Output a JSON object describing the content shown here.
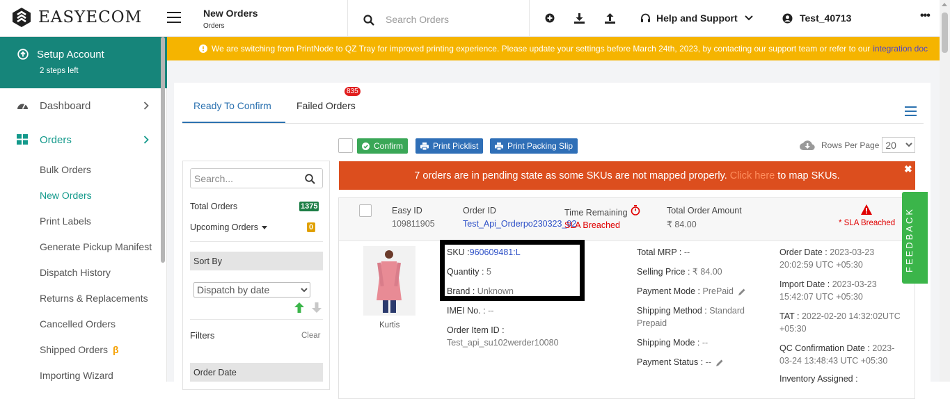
{
  "app": {
    "brand": "EASYECOM"
  },
  "header": {
    "page_title": "New Orders",
    "breadcrumb": "Orders",
    "search_placeholder": "Search Orders",
    "help_label": "Help and Support",
    "user_label": "Test_40713",
    "more_label": "•••"
  },
  "sidebar": {
    "setup": {
      "title": "Setup Account",
      "subtitle": "2 steps left"
    },
    "main_items": [
      {
        "label": "Dashboard",
        "icon": "dashboard-gauge-icon",
        "active": false
      },
      {
        "label": "Orders",
        "icon": "grid-icon",
        "active": true
      }
    ],
    "sub_items": [
      {
        "label": "Bulk Orders",
        "active": false
      },
      {
        "label": "New Orders",
        "active": true
      },
      {
        "label": "Print Labels",
        "active": false
      },
      {
        "label": "Generate Pickup Manifest",
        "active": false
      },
      {
        "label": "Dispatch History",
        "active": false
      },
      {
        "label": "Returns & Replacements",
        "active": false
      },
      {
        "label": "Cancelled Orders",
        "active": false
      },
      {
        "label": "Shipped Orders",
        "active": false,
        "beta": "β"
      },
      {
        "label": "Importing Wizard",
        "active": false
      }
    ]
  },
  "notice": {
    "message": "We are switching from PrintNode to QZ Tray for improved printing experience. Please update your settings before March 24th, 2023, by contacting our support team or refer to our",
    "link": "integration doc"
  },
  "tabs": [
    {
      "label": "Ready To Confirm",
      "active": true
    },
    {
      "label": "Failed Orders",
      "active": false,
      "badge": "835"
    }
  ],
  "toolbar": {
    "confirm": "Confirm",
    "print_picklist": "Print Picklist",
    "print_packing_slip": "Print Packing Slip",
    "rows_per_page_label": "Rows Per Page",
    "rows_per_page_value": "20"
  },
  "filters": {
    "search_placeholder": "Search...",
    "total_orders_label": "Total Orders",
    "total_orders_count": "1375",
    "upcoming_orders_label": "Upcoming Orders",
    "upcoming_orders_count": "0",
    "sort_by_label": "Sort By",
    "sort_value": "Dispatch by date",
    "filters_label": "Filters",
    "clear_label": "Clear",
    "order_date_label": "Order Date"
  },
  "alert": {
    "message": "7 orders are in pending state as some SKUs are not mapped properly.",
    "link": "Click here",
    "suffix": "to map SKUs.",
    "close": "✖"
  },
  "order": {
    "easy_id_label": "Easy ID",
    "easy_id": "109811905",
    "order_id_label": "Order ID",
    "order_id": "Test_Api_Orderpo230323_92",
    "time_remaining_label": "Time Remaining",
    "time_remaining_value": "SLA Breached",
    "total_amount_label": "Total Order Amount",
    "total_amount": "₹ 84.00",
    "sla_status": "* SLA Breached",
    "product_caption": "Kurtis",
    "sku_label": "SKU :",
    "sku": "960609481:L",
    "quantity_label": "Quantity :",
    "quantity": "5",
    "brand_label": "Brand :",
    "brand": "Unknown",
    "imei_label": "IMEI No. :",
    "imei": "--",
    "order_item_id_label": "Order Item ID :",
    "order_item_id": "Test_api_su102werder10080",
    "total_mrp_label": "Total MRP :",
    "total_mrp": "--",
    "selling_price_label": "Selling Price :",
    "selling_price": "₹ 84.00",
    "payment_mode_label": "Payment Mode :",
    "payment_mode": "PrePaid",
    "shipping_method_label": "Shipping Method :",
    "shipping_method": "Standard Prepaid",
    "shipping_mode_label": "Shipping Mode :",
    "shipping_mode": "--",
    "payment_status_label": "Payment Status :",
    "payment_status": "--",
    "order_date_label": "Order Date :",
    "order_date": "2023-03-23 20:02:59 UTC +05:30",
    "import_date_label": "Import Date :",
    "import_date": "2023-03-23 15:42:07 UTC +05:30",
    "tat_label": "TAT :",
    "tat": "2022-02-20 14:32:02UTC +05:30",
    "qc_label": "QC Confirmation Date :",
    "qc_date": "2023-03-24 13:48:43 UTC +05:30",
    "inventory_label": "Inventory Assigned :"
  },
  "feedback": "FEEDBACK",
  "colors": {
    "teal": "#16857a",
    "notice": "#f5b400",
    "alert": "#dc4e1e",
    "primary": "#2c72b0",
    "success": "#3aa757"
  }
}
